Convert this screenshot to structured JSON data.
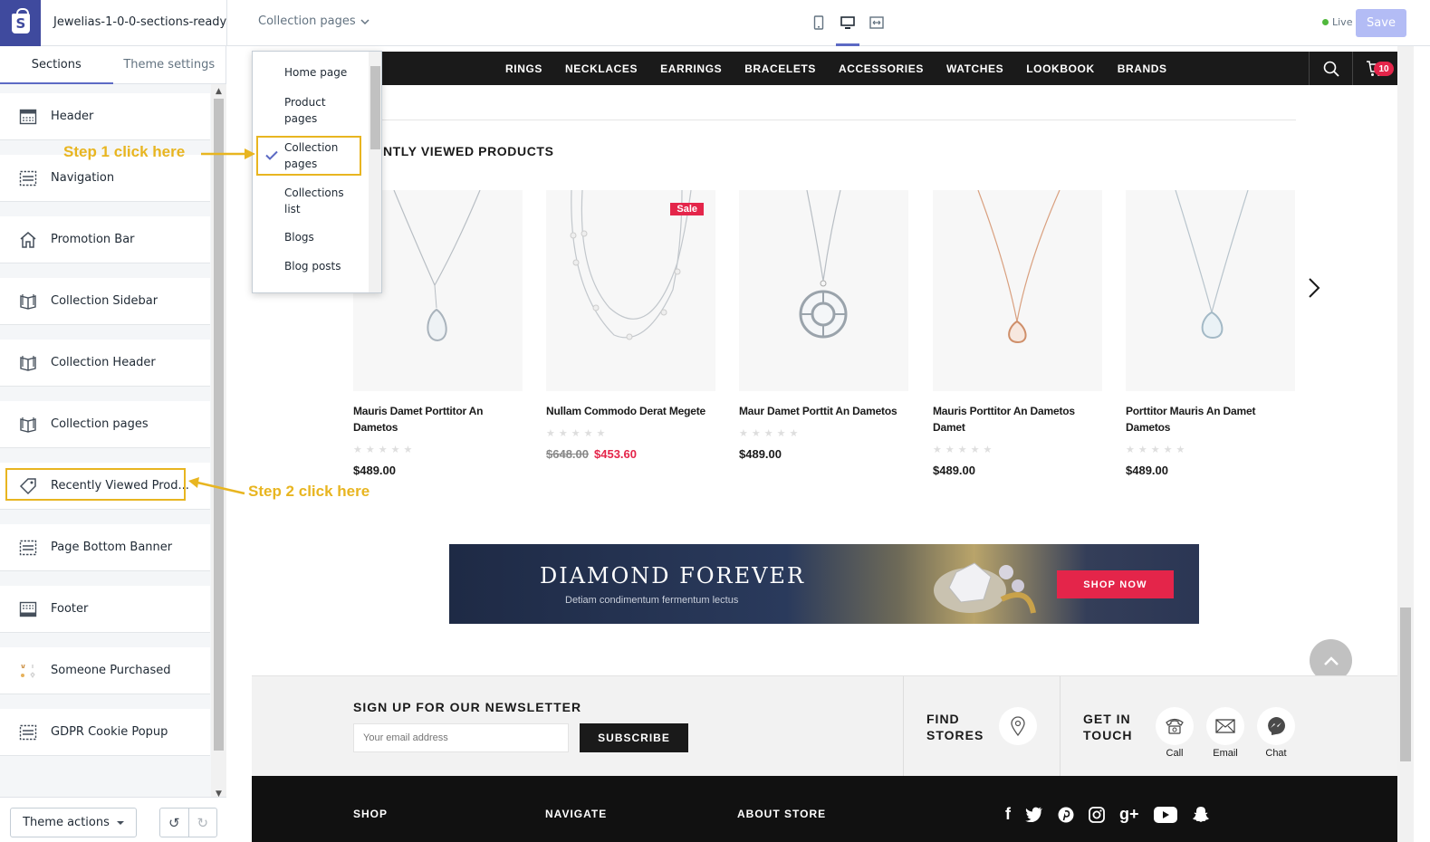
{
  "topbar": {
    "theme_name": "Jewelias-1-0-0-sections-ready",
    "page_selector": "Collection pages",
    "live_label": "Live",
    "save_label": "Save"
  },
  "sidebar": {
    "tabs": [
      "Sections",
      "Theme settings"
    ],
    "items": [
      {
        "label": "Header",
        "icon": "header-icon"
      },
      {
        "label": "Navigation",
        "icon": "navigation-icon"
      },
      {
        "label": "Promotion Bar",
        "icon": "home-icon"
      },
      {
        "label": "Collection Sidebar",
        "icon": "book-icon"
      },
      {
        "label": "Collection Header",
        "icon": "book-icon"
      },
      {
        "label": "Collection pages",
        "icon": "book-icon"
      },
      {
        "label": "Recently Viewed Prod...",
        "icon": "tag-icon"
      },
      {
        "label": "Page Bottom Banner",
        "icon": "section-icon"
      },
      {
        "label": "Footer",
        "icon": "footer-icon"
      },
      {
        "label": "Someone Purchased",
        "icon": "product-thumbnail-icon"
      },
      {
        "label": "GDPR Cookie Popup",
        "icon": "section-icon"
      }
    ],
    "theme_actions_label": "Theme actions"
  },
  "annotations": {
    "step1": "Step 1 click here",
    "step2": "Step 2 click here"
  },
  "dropdown": {
    "options": [
      "Home page",
      "Product pages",
      "Collection pages",
      "Collections list",
      "Blogs",
      "Blog posts"
    ],
    "selected": "Collection pages"
  },
  "store": {
    "nav": [
      "RINGS",
      "NECKLACES",
      "EARRINGS",
      "BRACELETS",
      "ACCESSORIES",
      "WATCHES",
      "LOOKBOOK",
      "BRANDS"
    ],
    "cart_count": "10",
    "recently_viewed_title": "ENTLY VIEWED PRODUCTS",
    "products": [
      {
        "name": "Mauris Damet Porttitor An Dametos",
        "price": "$489.00",
        "old_price": "",
        "sale": ""
      },
      {
        "name": "Nullam Commodo Derat Megete",
        "price": "$453.60",
        "old_price": "$648.00",
        "sale": "Sale"
      },
      {
        "name": "Maur Damet Porttit An Dametos",
        "price": "$489.00",
        "old_price": "",
        "sale": ""
      },
      {
        "name": "Mauris Porttitor An Dametos Damet",
        "price": "$489.00",
        "old_price": "",
        "sale": ""
      },
      {
        "name": "Porttitor Mauris An Damet Dametos",
        "price": "$489.00",
        "old_price": "",
        "sale": ""
      }
    ],
    "stars": "★★★★★",
    "banner": {
      "title": "DIAMOND FOREVER",
      "subtitle": "Detiam condimentum fermentum lectus",
      "button": "SHOP NOW"
    },
    "newsletter": {
      "title": "SIGN UP FOR OUR NEWSLETTER",
      "placeholder": "Your email address",
      "button": "SUBSCRIBE"
    },
    "find_stores": "FIND STORES",
    "get_in_touch": "GET IN TOUCH",
    "contact": [
      "Call",
      "Email",
      "Chat"
    ],
    "footer_cols": [
      "SHOP",
      "NAVIGATE",
      "ABOUT STORE"
    ],
    "social": [
      "facebook-icon",
      "twitter-icon",
      "pinterest-icon",
      "instagram-icon",
      "google-plus-icon",
      "youtube-icon",
      "snapchat-icon"
    ]
  },
  "colors": {
    "brand": "#3f4a9e",
    "accent": "#5c6ac4",
    "annotation": "#e8b520",
    "sale": "#e4254a"
  }
}
